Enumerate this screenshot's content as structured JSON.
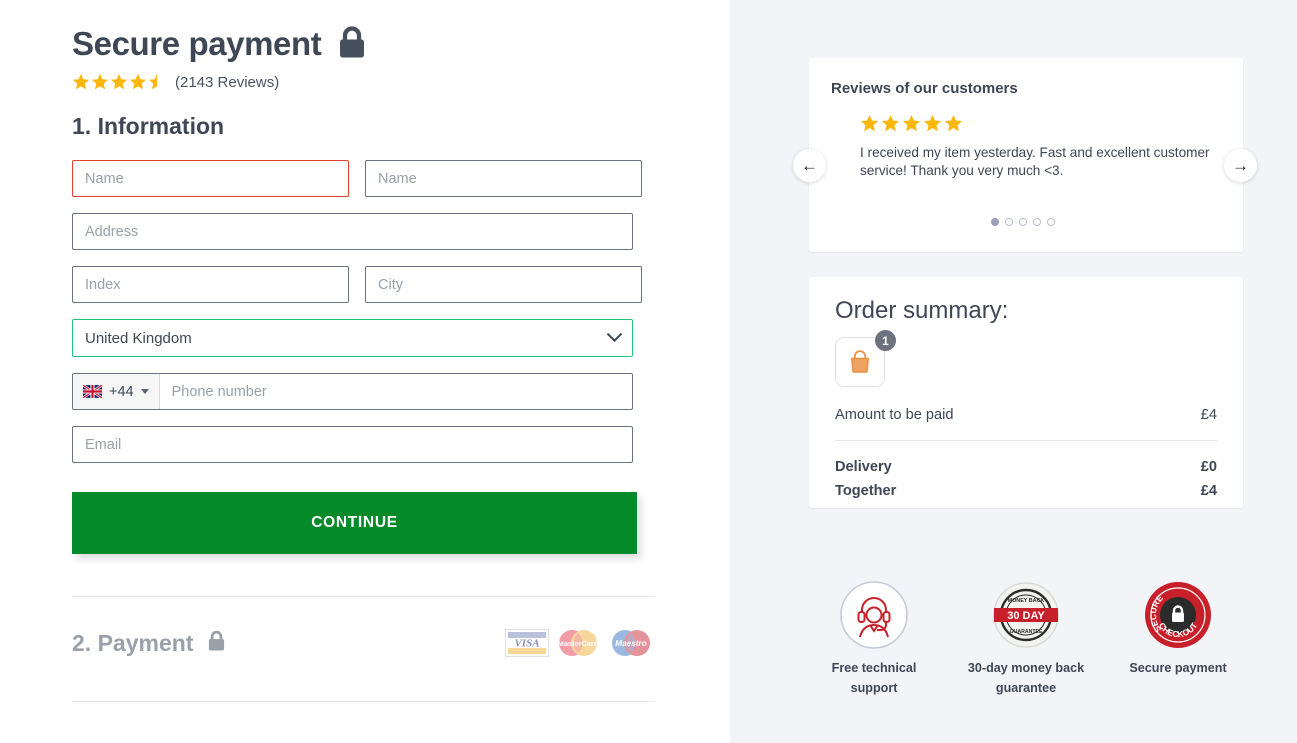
{
  "header": {
    "title": "Secure payment",
    "lock_icon": "lock-icon",
    "rating_value": 4.5,
    "rating_max": 5,
    "reviews_text": "(2143 Reviews)",
    "star_color": "#fcb70a"
  },
  "information": {
    "section_title": "1. Information",
    "fields": {
      "first_name_placeholder": "Name",
      "last_name_placeholder": "Name",
      "address_placeholder": "Address",
      "index_placeholder": "Index",
      "city_placeholder": "City",
      "country_value": "United Kingdom",
      "phone_dial_code": "+44",
      "phone_placeholder": "Phone number",
      "email_placeholder": "Email"
    },
    "validation": {
      "error_color": "#e0402c",
      "valid_color": "#22c176"
    },
    "continue_label": "CONTINUE",
    "continue_color": "#048a28"
  },
  "payment": {
    "section_title": "2. Payment",
    "lock_icon": "lock-icon",
    "cards": [
      "VISA",
      "MasterCard",
      "Maestro"
    ]
  },
  "reviews": {
    "heading": "Reviews of our customers",
    "stars": 5,
    "text": "I received my item yesterday. Fast and excellent customer service! Thank you very much <3.",
    "dots_total": 5,
    "dots_active_index": 0,
    "prev_icon": "arrow-left-icon",
    "next_icon": "arrow-right-icon"
  },
  "order_summary": {
    "title": "Order summary:",
    "item_icon": "shopping-bag-icon",
    "item_quantity": "1",
    "amount_label": "Amount to be paid",
    "amount_value": "£4",
    "delivery_label": "Delivery",
    "delivery_value": "£0",
    "together_label": "Together",
    "together_value": "£4"
  },
  "trust_badges": [
    {
      "icon": "headset-support-icon",
      "label": "Free technical support"
    },
    {
      "icon": "money-back-seal-icon",
      "label": "30-day money back guarantee",
      "seal_text": "30 DAY"
    },
    {
      "icon": "secure-checkout-seal-icon",
      "label": "Secure payment",
      "seal_top": "SECURE",
      "seal_bottom": "CHECKOUT"
    }
  ]
}
